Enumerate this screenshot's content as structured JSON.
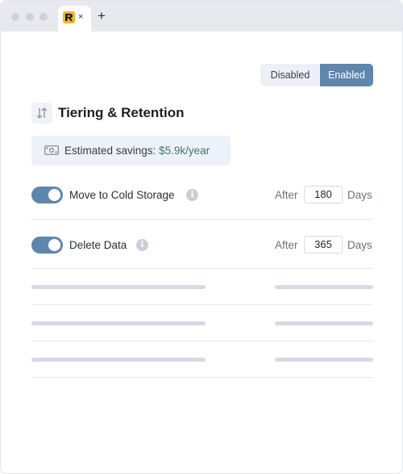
{
  "browser": {
    "tab_close": "×",
    "new_tab": "+"
  },
  "toggle": {
    "disabled_label": "Disabled",
    "enabled_label": "Enabled",
    "selected": "Enabled"
  },
  "section": {
    "icon": "sort-arrows-icon",
    "title": "Tiering & Retention"
  },
  "savings": {
    "icon": "money-icon",
    "label": "Estimated savings:",
    "value": "$5.9k/year"
  },
  "rules": [
    {
      "label": "Move to Cold Storage",
      "enabled": true,
      "after_label": "After",
      "value": "180",
      "unit": "Days"
    },
    {
      "label": "Delete Data",
      "enabled": true,
      "after_label": "After",
      "value": "365",
      "unit": "Days"
    }
  ],
  "info_glyph": "i",
  "colors": {
    "accent": "#5f86ad",
    "savings_bg": "#edf1f9",
    "savings_value": "#3e7a64"
  }
}
